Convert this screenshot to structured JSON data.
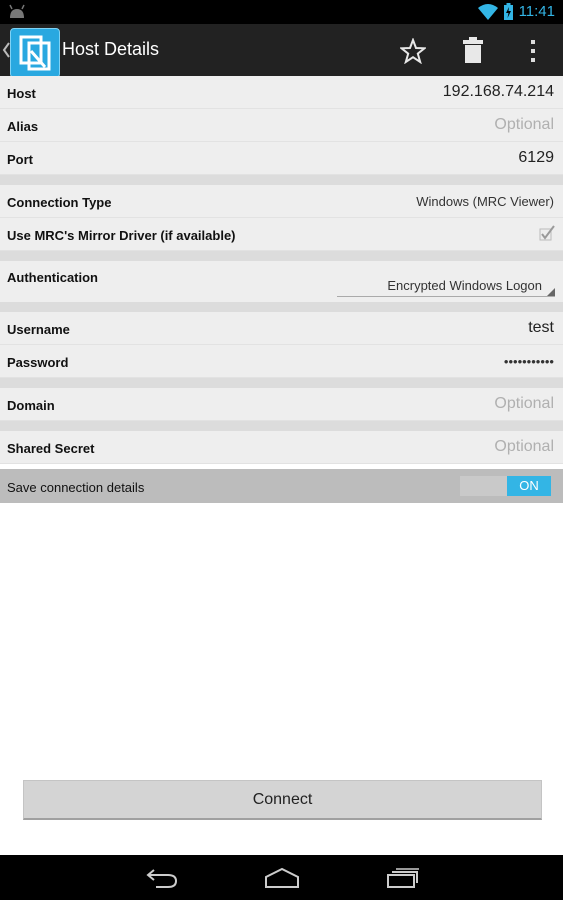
{
  "status_bar": {
    "time": "11:41"
  },
  "action_bar": {
    "title": "Host Details",
    "icons": [
      "back-chevron-icon",
      "app-icon",
      "star-icon",
      "trash-icon",
      "overflow-menu-icon"
    ]
  },
  "form": {
    "host": {
      "label": "Host",
      "value": "192.168.74.214"
    },
    "alias": {
      "label": "Alias",
      "placeholder": "Optional"
    },
    "port": {
      "label": "Port",
      "value": "6129"
    },
    "connection_type": {
      "label": "Connection Type",
      "value": "Windows (MRC Viewer)"
    },
    "mirror_driver": {
      "label": "Use MRC's Mirror Driver (if available)",
      "checked": true
    },
    "authentication": {
      "label": "Authentication",
      "value": "Encrypted Windows Logon"
    },
    "username": {
      "label": "Username",
      "value": "test"
    },
    "password": {
      "label": "Password",
      "value": "•••••••••••"
    },
    "domain": {
      "label": "Domain",
      "placeholder": "Optional"
    },
    "shared_secret": {
      "label": "Shared Secret",
      "placeholder": "Optional"
    }
  },
  "save_details": {
    "label": "Save connection details",
    "toggle": "ON"
  },
  "connect_button": {
    "label": "Connect"
  },
  "colors": {
    "accent": "#33b5e5",
    "action_bar": "#222222",
    "background": "#eeeeee"
  }
}
